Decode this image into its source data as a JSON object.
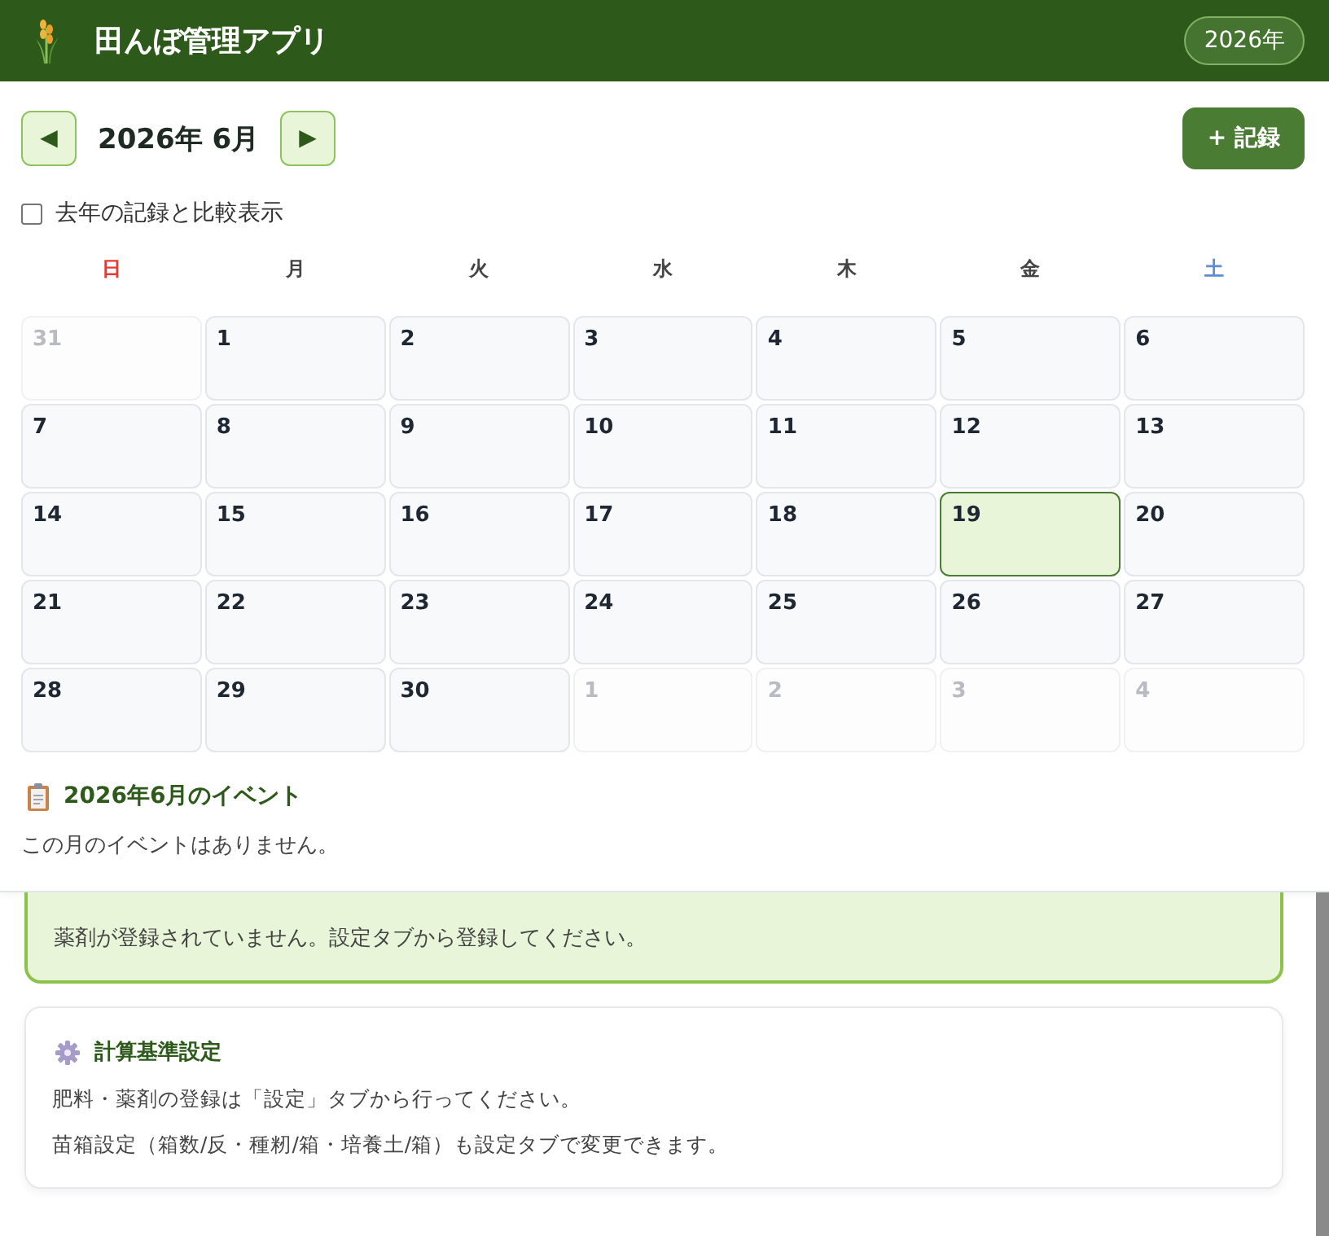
{
  "header": {
    "title": "田んぼ管理アプリ",
    "year_badge": "2026年"
  },
  "calendar": {
    "prev_button": "◀",
    "month_title": "2026年 6月",
    "next_button": "▶",
    "add_button": "+ 記録",
    "compare_checkbox": {
      "label": "去年の記録と比較表示",
      "checked": false
    },
    "weekdays": [
      {
        "label": "日",
        "kind": "sunday"
      },
      {
        "label": "月",
        "kind": "weekday"
      },
      {
        "label": "火",
        "kind": "weekday"
      },
      {
        "label": "水",
        "kind": "weekday"
      },
      {
        "label": "木",
        "kind": "weekday"
      },
      {
        "label": "金",
        "kind": "weekday"
      },
      {
        "label": "土",
        "kind": "saturday"
      }
    ],
    "weeks": [
      [
        {
          "day": "31",
          "other_month": true,
          "selected": false
        },
        {
          "day": "1",
          "other_month": false,
          "selected": false
        },
        {
          "day": "2",
          "other_month": false,
          "selected": false
        },
        {
          "day": "3",
          "other_month": false,
          "selected": false
        },
        {
          "day": "4",
          "other_month": false,
          "selected": false
        },
        {
          "day": "5",
          "other_month": false,
          "selected": false
        },
        {
          "day": "6",
          "other_month": false,
          "selected": false
        }
      ],
      [
        {
          "day": "7",
          "other_month": false,
          "selected": false
        },
        {
          "day": "8",
          "other_month": false,
          "selected": false
        },
        {
          "day": "9",
          "other_month": false,
          "selected": false
        },
        {
          "day": "10",
          "other_month": false,
          "selected": false
        },
        {
          "day": "11",
          "other_month": false,
          "selected": false
        },
        {
          "day": "12",
          "other_month": false,
          "selected": false
        },
        {
          "day": "13",
          "other_month": false,
          "selected": false
        }
      ],
      [
        {
          "day": "14",
          "other_month": false,
          "selected": false
        },
        {
          "day": "15",
          "other_month": false,
          "selected": false
        },
        {
          "day": "16",
          "other_month": false,
          "selected": false
        },
        {
          "day": "17",
          "other_month": false,
          "selected": false
        },
        {
          "day": "18",
          "other_month": false,
          "selected": false
        },
        {
          "day": "19",
          "other_month": false,
          "selected": true
        },
        {
          "day": "20",
          "other_month": false,
          "selected": false
        }
      ],
      [
        {
          "day": "21",
          "other_month": false,
          "selected": false
        },
        {
          "day": "22",
          "other_month": false,
          "selected": false
        },
        {
          "day": "23",
          "other_month": false,
          "selected": false
        },
        {
          "day": "24",
          "other_month": false,
          "selected": false
        },
        {
          "day": "25",
          "other_month": false,
          "selected": false
        },
        {
          "day": "26",
          "other_month": false,
          "selected": false
        },
        {
          "day": "27",
          "other_month": false,
          "selected": false
        }
      ],
      [
        {
          "day": "28",
          "other_month": false,
          "selected": false
        },
        {
          "day": "29",
          "other_month": false,
          "selected": false
        },
        {
          "day": "30",
          "other_month": false,
          "selected": false
        },
        {
          "day": "1",
          "other_month": true,
          "selected": false
        },
        {
          "day": "2",
          "other_month": true,
          "selected": false
        },
        {
          "day": "3",
          "other_month": true,
          "selected": false
        },
        {
          "day": "4",
          "other_month": true,
          "selected": false
        }
      ]
    ]
  },
  "events": {
    "title": "2026年6月のイベント",
    "empty_message": "この月のイベントはありません。"
  },
  "notice": {
    "text": "薬剤が登録されていません。設定タブから登録してください。"
  },
  "settings_card": {
    "title": "計算基準設定",
    "paragraphs": [
      "肥料・薬剤の登録は「設定」タブから行ってください。",
      "苗箱設定（箱数/反・種籾/箱・培養土/箱）も設定タブで変更できます。"
    ]
  }
}
